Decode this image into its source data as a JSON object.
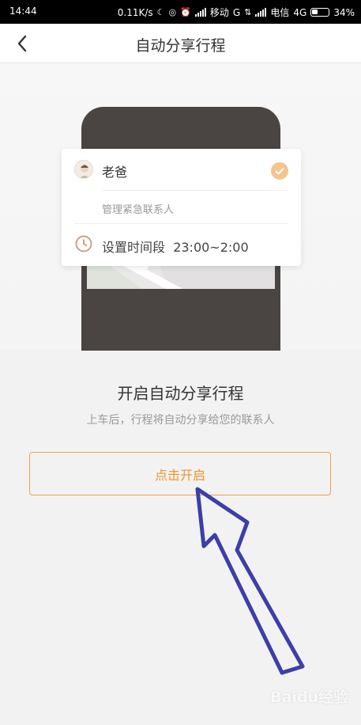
{
  "status_bar": {
    "time": "14:44",
    "speed": "0.11K/s",
    "carrier1": "移动",
    "net1": "G",
    "carrier2": "电信",
    "net2": "4G",
    "battery": "34%"
  },
  "header": {
    "title": "自动分享行程"
  },
  "card": {
    "contact_name": "老爸",
    "manage_label": "管理紧急联系人",
    "time_label": "设置时间段",
    "time_range": "23:00~2:00"
  },
  "main": {
    "title": "开启自动分享行程",
    "subtitle": "上车后，行程将自动分享给您的联系人",
    "button_label": "点击开启"
  },
  "watermark": "Baidu经验",
  "colors": {
    "accent": "#f0932e",
    "check_bg": "#f5c48e",
    "arrow": "#3b3fa8",
    "phone": "#4a4542"
  }
}
